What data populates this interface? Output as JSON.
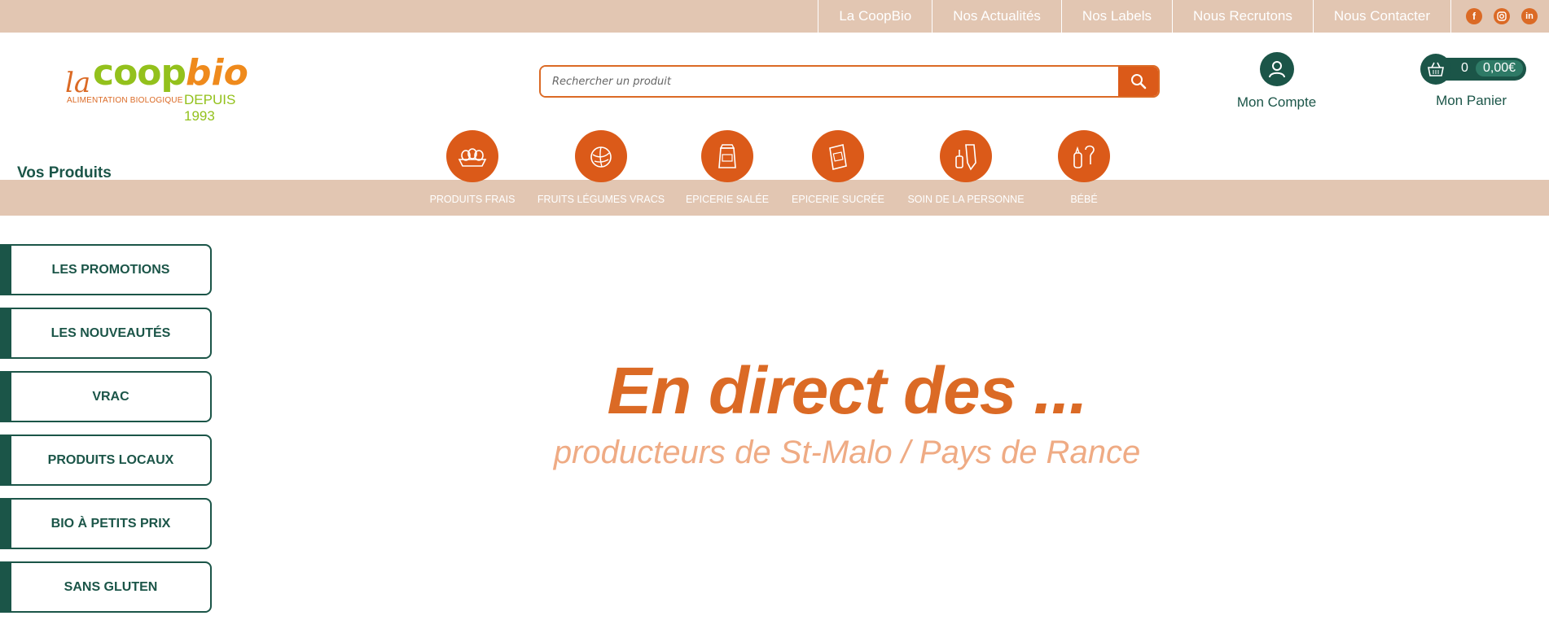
{
  "topbar": {
    "links": [
      "La CoopBio",
      "Nos Actualités",
      "Nos Labels",
      "Nous Recrutons",
      "Nous Contacter"
    ],
    "social": [
      "facebook-icon",
      "instagram-icon",
      "linkedin-icon"
    ]
  },
  "logo": {
    "la": "la",
    "coop": "coop",
    "bio": "bio",
    "tagline": "ALIMENTATION BIOLOGIQUE",
    "since": "DEPUIS 1993"
  },
  "search": {
    "placeholder": "Rechercher un produit"
  },
  "account": {
    "label": "Mon Compte"
  },
  "cart": {
    "count": "0",
    "amount": "0,00€",
    "label": "Mon Panier"
  },
  "products": {
    "title": "Vos Produits",
    "categories": [
      {
        "label": "PRODUITS FRAIS",
        "icon": "eggs-icon"
      },
      {
        "label": "FRUITS LÉGUMES VRACS",
        "icon": "cabbage-icon"
      },
      {
        "label": "EPICERIE SALÉE",
        "icon": "salt-bag-icon"
      },
      {
        "label": "EPICERIE SUCRÉE",
        "icon": "sugar-box-icon"
      },
      {
        "label": "SOIN DE LA PERSONNE",
        "icon": "toiletries-icon"
      },
      {
        "label": "BÉBÉ",
        "icon": "baby-bottle-icon"
      }
    ]
  },
  "sidebar": {
    "items": [
      "LES PROMOTIONS",
      "LES NOUVEAUTÉS",
      "VRAC",
      "PRODUITS LOCAUX",
      "BIO À PETITS PRIX",
      "SANS GLUTEN"
    ]
  },
  "hero": {
    "title": "En direct des ...",
    "subtitle": "producteurs de St-Malo / Pays de Rance"
  },
  "colors": {
    "brand_green": "#1b5548",
    "brand_orange": "#db5a19",
    "band_beige": "#e2c6b2"
  }
}
